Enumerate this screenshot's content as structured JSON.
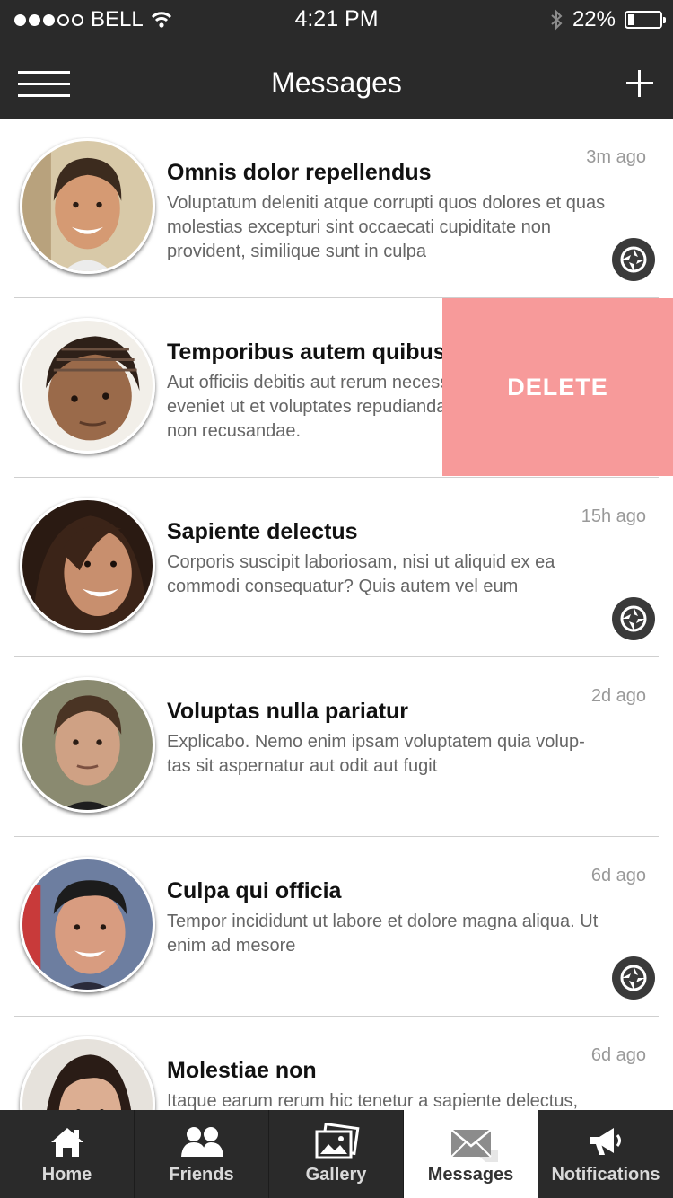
{
  "status_bar": {
    "carrier": "BELL",
    "time": "4:21 PM",
    "battery_text": "22%",
    "battery_level": 0.22,
    "signal_bars_filled": 3,
    "signal_bars_total": 5
  },
  "nav": {
    "title": "Messages",
    "menu_icon": "hamburger-icon",
    "add_icon": "plus-icon"
  },
  "messages": [
    {
      "name": "Omnis dolor repellendus",
      "preview": "Voluptatum deleniti atque corrupti quos dolores et quas molestias excepturi sint occaecati cupiditate non provident, similique sunt in culpa",
      "time": "3m ago",
      "has_badge": true
    },
    {
      "name": "Temporibus autem quibusdam",
      "preview": "Aut officiis debitis aut rerum necessitatibus saepe eveniet ut et voluptates repudiandae sint et molestiae non recusandae.",
      "time": "",
      "has_badge": false,
      "swiped": true,
      "action_label": "DELETE"
    },
    {
      "name": "Sapiente delectus",
      "preview": "Corporis suscipit laboriosam, nisi ut aliquid ex ea commodi consequatur? Quis autem vel eum",
      "time": "15h ago",
      "has_badge": true
    },
    {
      "name": "Voluptas nulla pariatur",
      "preview": "Explicabo. Nemo enim ipsam voluptatem quia volup-tas sit aspernatur aut odit aut fugit",
      "time": "2d ago",
      "has_badge": false
    },
    {
      "name": "Culpa qui officia",
      "preview": "Tempor incididunt ut labore et dolore magna aliqua. Ut enim ad mesore",
      "time": "6d ago",
      "has_badge": true
    },
    {
      "name": "Molestiae non",
      "preview": "Itaque earum rerum hic tenetur a sapiente delectus,",
      "time": "6d ago",
      "has_badge": false
    }
  ],
  "tabs": [
    {
      "label": "Home",
      "icon": "home-icon",
      "active": false
    },
    {
      "label": "Friends",
      "icon": "friends-icon",
      "active": false
    },
    {
      "label": "Gallery",
      "icon": "gallery-icon",
      "active": false
    },
    {
      "label": "Messages",
      "icon": "envelope-icon",
      "active": true
    },
    {
      "label": "Notifications",
      "icon": "megaphone-icon",
      "active": false
    }
  ],
  "colors": {
    "bar": "#2a2a2a",
    "delete": "#f79a9a",
    "badge": "#3a3a3a"
  }
}
